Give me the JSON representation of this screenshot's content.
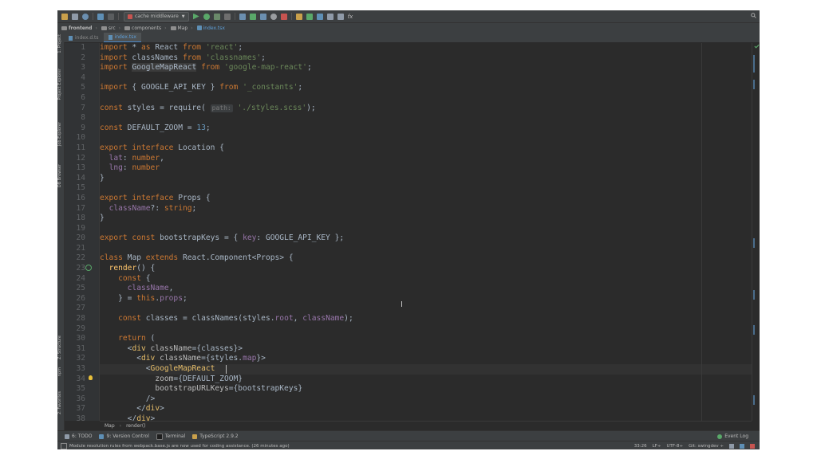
{
  "toolbar": {
    "run_config": "cache middleware",
    "icons": [
      "open-icon",
      "save-icon",
      "sync-icon",
      "back-icon",
      "forward-icon",
      "run-icon",
      "debug-icon",
      "coverage-icon",
      "stop-icon",
      "vcs-update-icon",
      "vcs-commit-icon",
      "vcs-compare-icon",
      "vcs-history-icon",
      "revert-icon",
      "build-icon",
      "settings-icon",
      "structure-icon",
      "project-structure-icon",
      "presentation-icon",
      "function-icon",
      "search-icon"
    ]
  },
  "breadcrumb": [
    "frontend",
    "src",
    "components",
    "Map",
    "index.tsx"
  ],
  "tabs": [
    {
      "label": "index.d.ts",
      "active": false
    },
    {
      "label": "index.tsx",
      "active": true
    }
  ],
  "left_stripe": {
    "top_labels": [
      "1: Project",
      "Project Explorer",
      "Job Explorer",
      "DB Browser"
    ],
    "bottom_labels": [
      "Z: Structure",
      "npm",
      "2: Favorites"
    ]
  },
  "code": {
    "line_numbers": [
      "1",
      "2",
      "3",
      "4",
      "5",
      "6",
      "7",
      "8",
      "9",
      "10",
      "11",
      "12",
      "13",
      "14",
      "15",
      "16",
      "17",
      "18",
      "19",
      "20",
      "21",
      "22",
      "23",
      "24",
      "25",
      "26",
      "27",
      "28",
      "29",
      "30",
      "31",
      "32",
      "33",
      "34",
      "35",
      "36",
      "37",
      "38"
    ],
    "path_hint": "path:",
    "cursor_line": 33
  },
  "code_breadcrumb": [
    "Map",
    "render()"
  ],
  "bottom_tabs": [
    {
      "label": "6: TODO",
      "icon": "todo-icon"
    },
    {
      "label": "9: Version Control",
      "icon": "version-control-icon"
    },
    {
      "label": "Terminal",
      "icon": "terminal-icon"
    },
    {
      "label": "TypeScript 2.9.2",
      "icon": "typescript-icon"
    }
  ],
  "event_log": "Event Log",
  "status": {
    "message": "Module resolution rules from webpack.base.js are now used for coding assistance. (26 minutes ago)",
    "position": "33:26",
    "line_sep": "LF÷",
    "encoding": "UTF-8÷",
    "git": "Git: swingdev ÷"
  },
  "colors": {
    "background": "#2b2b2b",
    "keyword": "#cc7832",
    "string": "#6a8759",
    "number": "#6897bb",
    "property": "#9876aa",
    "tag": "#e8bf6a"
  }
}
